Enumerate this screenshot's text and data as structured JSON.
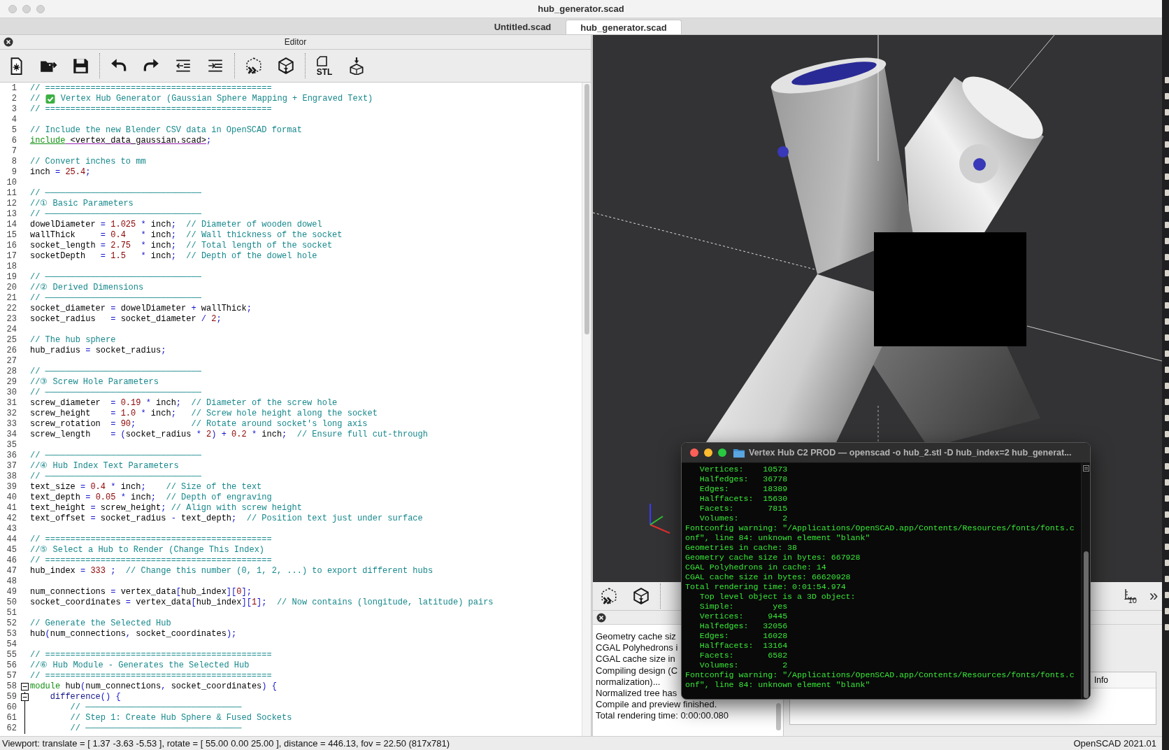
{
  "window": {
    "title": "hub_generator.scad"
  },
  "tabs": [
    {
      "label": "Untitled.scad",
      "selected": false
    },
    {
      "label": "hub_generator.scad",
      "selected": true
    }
  ],
  "editor": {
    "title": "Editor",
    "toolbar": [
      {
        "kind": "new"
      },
      {
        "kind": "open"
      },
      {
        "kind": "save"
      },
      {
        "kind": "separator"
      },
      {
        "kind": "undo"
      },
      {
        "kind": "redo"
      },
      {
        "kind": "unindent"
      },
      {
        "kind": "indent"
      },
      {
        "kind": "separator"
      },
      {
        "kind": "preview"
      },
      {
        "kind": "render"
      },
      {
        "kind": "separator"
      },
      {
        "kind": "export_stl",
        "label": "STL"
      },
      {
        "kind": "print"
      }
    ],
    "lines": [
      {
        "number": "1",
        "segments": [
          {
            "kind": "comment",
            "text": "// ============================================="
          }
        ]
      },
      {
        "number": "2",
        "segments": [
          {
            "kind": "comment",
            "text": "// "
          },
          {
            "kind": "emoji"
          },
          {
            "kind": "comment",
            "text": " Vertex Hub Generator (Gaussian Sphere Mapping + Engraved Text)"
          }
        ]
      },
      {
        "number": "3",
        "segments": [
          {
            "kind": "comment",
            "text": "// ============================================="
          }
        ]
      },
      {
        "number": "4"
      },
      {
        "number": "5",
        "segments": [
          {
            "kind": "comment",
            "text": "// Include the new Blender CSV data in OpenSCAD format"
          }
        ]
      },
      {
        "number": "6",
        "segments": [
          {
            "kind": "include",
            "text": "include"
          },
          {
            "kind": "path",
            "text": " <vertex_data_gaussian.scad>"
          },
          {
            "kind": "op",
            "text": ";"
          }
        ]
      },
      {
        "number": "7"
      },
      {
        "number": "8",
        "segments": [
          {
            "kind": "comment",
            "text": "// Convert inches to mm"
          }
        ]
      },
      {
        "number": "9",
        "segments": [
          {
            "kind": "plain",
            "text": "inch "
          },
          {
            "kind": "op",
            "text": "= "
          },
          {
            "kind": "number",
            "text": "25.4"
          },
          {
            "kind": "op",
            "text": ";"
          }
        ]
      },
      {
        "number": "10"
      },
      {
        "number": "11",
        "segments": [
          {
            "kind": "comment",
            "text": "// ───────────────────────────────"
          }
        ]
      },
      {
        "number": "12",
        "segments": [
          {
            "kind": "comment",
            "text": "//① Basic Parameters"
          }
        ]
      },
      {
        "number": "13",
        "segments": [
          {
            "kind": "comment",
            "text": "// ───────────────────────────────"
          }
        ]
      },
      {
        "number": "14",
        "segments": [
          {
            "kind": "plain",
            "text": "dowelDiameter "
          },
          {
            "kind": "op",
            "text": "= "
          },
          {
            "kind": "number",
            "text": "1.025 "
          },
          {
            "kind": "op",
            "text": "* "
          },
          {
            "kind": "plain",
            "text": "inch"
          },
          {
            "kind": "op",
            "text": ";  "
          },
          {
            "kind": "comment",
            "text": "// Diameter of wooden dowel"
          }
        ]
      },
      {
        "number": "15",
        "segments": [
          {
            "kind": "plain",
            "text": "wallThick     "
          },
          {
            "kind": "op",
            "text": "= "
          },
          {
            "kind": "number",
            "text": "0.4   "
          },
          {
            "kind": "op",
            "text": "* "
          },
          {
            "kind": "plain",
            "text": "inch"
          },
          {
            "kind": "op",
            "text": ";  "
          },
          {
            "kind": "comment",
            "text": "// Wall thickness of the socket"
          }
        ]
      },
      {
        "number": "16",
        "segments": [
          {
            "kind": "plain",
            "text": "socket_length "
          },
          {
            "kind": "op",
            "text": "= "
          },
          {
            "kind": "number",
            "text": "2.75  "
          },
          {
            "kind": "op",
            "text": "* "
          },
          {
            "kind": "plain",
            "text": "inch"
          },
          {
            "kind": "op",
            "text": ";  "
          },
          {
            "kind": "comment",
            "text": "// Total length of the socket"
          }
        ]
      },
      {
        "number": "17",
        "segments": [
          {
            "kind": "plain",
            "text": "socketDepth   "
          },
          {
            "kind": "op",
            "text": "= "
          },
          {
            "kind": "number",
            "text": "1.5   "
          },
          {
            "kind": "op",
            "text": "* "
          },
          {
            "kind": "plain",
            "text": "inch"
          },
          {
            "kind": "op",
            "text": ";  "
          },
          {
            "kind": "comment",
            "text": "// Depth of the dowel hole"
          }
        ]
      },
      {
        "number": "18"
      },
      {
        "number": "19",
        "segments": [
          {
            "kind": "comment",
            "text": "// ───────────────────────────────"
          }
        ]
      },
      {
        "number": "20",
        "segments": [
          {
            "kind": "comment",
            "text": "//② Derived Dimensions"
          }
        ]
      },
      {
        "number": "21",
        "segments": [
          {
            "kind": "comment",
            "text": "// ───────────────────────────────"
          }
        ]
      },
      {
        "number": "22",
        "segments": [
          {
            "kind": "plain",
            "text": "socket_diameter "
          },
          {
            "kind": "op",
            "text": "= "
          },
          {
            "kind": "plain",
            "text": "dowelDiameter "
          },
          {
            "kind": "op",
            "text": "+ "
          },
          {
            "kind": "plain",
            "text": "wallThick"
          },
          {
            "kind": "op",
            "text": ";"
          }
        ]
      },
      {
        "number": "23",
        "segments": [
          {
            "kind": "plain",
            "text": "socket_radius   "
          },
          {
            "kind": "op",
            "text": "= "
          },
          {
            "kind": "plain",
            "text": "socket_diameter "
          },
          {
            "kind": "op",
            "text": "/ "
          },
          {
            "kind": "number",
            "text": "2"
          },
          {
            "kind": "op",
            "text": ";"
          }
        ]
      },
      {
        "number": "24"
      },
      {
        "number": "25",
        "segments": [
          {
            "kind": "comment",
            "text": "// The hub sphere"
          }
        ]
      },
      {
        "number": "26",
        "segments": [
          {
            "kind": "plain",
            "text": "hub_radius "
          },
          {
            "kind": "op",
            "text": "= "
          },
          {
            "kind": "plain",
            "text": "socket_radius"
          },
          {
            "kind": "op",
            "text": ";"
          }
        ]
      },
      {
        "number": "27"
      },
      {
        "number": "28",
        "segments": [
          {
            "kind": "comment",
            "text": "// ───────────────────────────────"
          }
        ]
      },
      {
        "number": "29",
        "segments": [
          {
            "kind": "comment",
            "text": "//③ Screw Hole Parameters"
          }
        ]
      },
      {
        "number": "30",
        "segments": [
          {
            "kind": "comment",
            "text": "// ───────────────────────────────"
          }
        ]
      },
      {
        "number": "31",
        "segments": [
          {
            "kind": "plain",
            "text": "screw_diameter  "
          },
          {
            "kind": "op",
            "text": "= "
          },
          {
            "kind": "number",
            "text": "0.19 "
          },
          {
            "kind": "op",
            "text": "* "
          },
          {
            "kind": "plain",
            "text": "inch"
          },
          {
            "kind": "op",
            "text": ";  "
          },
          {
            "kind": "comment",
            "text": "// Diameter of the screw hole"
          }
        ]
      },
      {
        "number": "32",
        "segments": [
          {
            "kind": "plain",
            "text": "screw_height    "
          },
          {
            "kind": "op",
            "text": "= "
          },
          {
            "kind": "number",
            "text": "1.0 "
          },
          {
            "kind": "op",
            "text": "* "
          },
          {
            "kind": "plain",
            "text": "inch"
          },
          {
            "kind": "op",
            "text": ";   "
          },
          {
            "kind": "comment",
            "text": "// Screw hole height along the socket"
          }
        ]
      },
      {
        "number": "33",
        "segments": [
          {
            "kind": "plain",
            "text": "screw_rotation  "
          },
          {
            "kind": "op",
            "text": "= "
          },
          {
            "kind": "number",
            "text": "90"
          },
          {
            "kind": "op",
            "text": ";           "
          },
          {
            "kind": "comment",
            "text": "// Rotate around socket's long axis"
          }
        ]
      },
      {
        "number": "34",
        "segments": [
          {
            "kind": "plain",
            "text": "screw_length    "
          },
          {
            "kind": "op",
            "text": "= ("
          },
          {
            "kind": "plain",
            "text": "socket_radius "
          },
          {
            "kind": "op",
            "text": "* "
          },
          {
            "kind": "number",
            "text": "2"
          },
          {
            "kind": "op",
            "text": ") + "
          },
          {
            "kind": "number",
            "text": "0.2 "
          },
          {
            "kind": "op",
            "text": "* "
          },
          {
            "kind": "plain",
            "text": "inch"
          },
          {
            "kind": "op",
            "text": ";  "
          },
          {
            "kind": "comment",
            "text": "// Ensure full cut-through"
          }
        ]
      },
      {
        "number": "35"
      },
      {
        "number": "36",
        "segments": [
          {
            "kind": "comment",
            "text": "// ───────────────────────────────"
          }
        ]
      },
      {
        "number": "37",
        "segments": [
          {
            "kind": "comment",
            "text": "//④ Hub Index Text Parameters"
          }
        ]
      },
      {
        "number": "38",
        "segments": [
          {
            "kind": "comment",
            "text": "// ───────────────────────────────"
          }
        ]
      },
      {
        "number": "39",
        "segments": [
          {
            "kind": "plain",
            "text": "text_size "
          },
          {
            "kind": "op",
            "text": "= "
          },
          {
            "kind": "number",
            "text": "0.4 "
          },
          {
            "kind": "op",
            "text": "* "
          },
          {
            "kind": "plain",
            "text": "inch"
          },
          {
            "kind": "op",
            "text": ";    "
          },
          {
            "kind": "comment",
            "text": "// Size of the text"
          }
        ]
      },
      {
        "number": "40",
        "segments": [
          {
            "kind": "plain",
            "text": "text_depth "
          },
          {
            "kind": "op",
            "text": "= "
          },
          {
            "kind": "number",
            "text": "0.05 "
          },
          {
            "kind": "op",
            "text": "* "
          },
          {
            "kind": "plain",
            "text": "inch"
          },
          {
            "kind": "op",
            "text": ";  "
          },
          {
            "kind": "comment",
            "text": "// Depth of engraving"
          }
        ]
      },
      {
        "number": "41",
        "segments": [
          {
            "kind": "plain",
            "text": "text_height "
          },
          {
            "kind": "op",
            "text": "= "
          },
          {
            "kind": "plain",
            "text": "screw_height"
          },
          {
            "kind": "op",
            "text": "; "
          },
          {
            "kind": "comment",
            "text": "// Align with screw height"
          }
        ]
      },
      {
        "number": "42",
        "segments": [
          {
            "kind": "plain",
            "text": "text_offset "
          },
          {
            "kind": "op",
            "text": "= "
          },
          {
            "kind": "plain",
            "text": "socket_radius "
          },
          {
            "kind": "op",
            "text": "- "
          },
          {
            "kind": "plain",
            "text": "text_depth"
          },
          {
            "kind": "op",
            "text": ";  "
          },
          {
            "kind": "comment",
            "text": "// Position text just under surface"
          }
        ]
      },
      {
        "number": "43"
      },
      {
        "number": "44",
        "segments": [
          {
            "kind": "comment",
            "text": "// ============================================="
          }
        ]
      },
      {
        "number": "45",
        "segments": [
          {
            "kind": "comment",
            "text": "//⑤ Select a Hub to Render (Change This Index)"
          }
        ]
      },
      {
        "number": "46",
        "segments": [
          {
            "kind": "comment",
            "text": "// ============================================="
          }
        ]
      },
      {
        "number": "47",
        "segments": [
          {
            "kind": "plain",
            "text": "hub_index "
          },
          {
            "kind": "op",
            "text": "= "
          },
          {
            "kind": "number",
            "text": "333 "
          },
          {
            "kind": "op",
            "text": ";  "
          },
          {
            "kind": "comment",
            "text": "// Change this number (0, 1, 2, ...) to export different hubs"
          }
        ]
      },
      {
        "number": "48"
      },
      {
        "number": "49",
        "segments": [
          {
            "kind": "plain",
            "text": "num_connections "
          },
          {
            "kind": "op",
            "text": "= "
          },
          {
            "kind": "plain",
            "text": "vertex_data"
          },
          {
            "kind": "op",
            "text": "["
          },
          {
            "kind": "plain",
            "text": "hub_index"
          },
          {
            "kind": "op",
            "text": "]["
          },
          {
            "kind": "number",
            "text": "0"
          },
          {
            "kind": "op",
            "text": "];"
          }
        ]
      },
      {
        "number": "50",
        "segments": [
          {
            "kind": "plain",
            "text": "socket_coordinates "
          },
          {
            "kind": "op",
            "text": "= "
          },
          {
            "kind": "plain",
            "text": "vertex_data"
          },
          {
            "kind": "op",
            "text": "["
          },
          {
            "kind": "plain",
            "text": "hub_index"
          },
          {
            "kind": "op",
            "text": "]["
          },
          {
            "kind": "number",
            "text": "1"
          },
          {
            "kind": "op",
            "text": "];  "
          },
          {
            "kind": "comment",
            "text": "// Now contains (longitude, latitude) pairs"
          }
        ]
      },
      {
        "number": "51"
      },
      {
        "number": "52",
        "segments": [
          {
            "kind": "comment",
            "text": "// Generate the Selected Hub"
          }
        ]
      },
      {
        "number": "53",
        "segments": [
          {
            "kind": "plain",
            "text": "hub"
          },
          {
            "kind": "op",
            "text": "("
          },
          {
            "kind": "plain",
            "text": "num_connections"
          },
          {
            "kind": "op",
            "text": ", "
          },
          {
            "kind": "plain",
            "text": "socket_coordinates"
          },
          {
            "kind": "op",
            "text": ");"
          }
        ]
      },
      {
        "number": "54"
      },
      {
        "number": "55",
        "segments": [
          {
            "kind": "comment",
            "text": "// ============================================="
          }
        ]
      },
      {
        "number": "56",
        "segments": [
          {
            "kind": "comment",
            "text": "//⑥ Hub Module - Generates the Selected Hub"
          }
        ]
      },
      {
        "number": "57",
        "segments": [
          {
            "kind": "comment",
            "text": "// ============================================="
          }
        ]
      },
      {
        "number": "58",
        "fold": {
          "expanded": true
        },
        "segments": [
          {
            "kind": "keyword",
            "text": "module"
          },
          {
            "kind": "plain",
            "text": " hub"
          },
          {
            "kind": "op",
            "text": "("
          },
          {
            "kind": "plain",
            "text": "num_connections"
          },
          {
            "kind": "op",
            "text": ", "
          },
          {
            "kind": "plain",
            "text": "socket_coordinates"
          },
          {
            "kind": "op",
            "text": ") {"
          }
        ]
      },
      {
        "number": "59",
        "fold": {
          "expanded": true
        },
        "segments": [
          {
            "kind": "builtin",
            "text": "    difference"
          },
          {
            "kind": "op",
            "text": "() {"
          }
        ]
      },
      {
        "number": "60",
        "segments": [
          {
            "kind": "comment",
            "text": "        // ───────────────────────────────"
          }
        ]
      },
      {
        "number": "61",
        "segments": [
          {
            "kind": "comment",
            "text": "        // Step 1: Create Hub Sphere & Fused Sockets"
          }
        ]
      },
      {
        "number": "62",
        "segments": [
          {
            "kind": "comment",
            "text": "        // ───────────────────────────────"
          }
        ]
      }
    ]
  },
  "viewport": {
    "kind": "picture",
    "toolbar": [
      {
        "kind": "preview"
      },
      {
        "kind": "render"
      },
      {
        "kind": "separator"
      },
      {
        "kind": "axes_scale",
        "label": "10"
      },
      {
        "kind": "more",
        "label": "»"
      }
    ]
  },
  "console": {
    "lines": [
      "Geometry cache siz",
      "CGAL Polyhedrons i",
      "CGAL cache size in",
      "Compiling design (C",
      "normalization)...",
      "Normalized tree has",
      "Compile and preview finished.",
      "Total rendering time: 0:00:00.080"
    ],
    "columns": [
      "Info"
    ]
  },
  "terminal": {
    "title": "Vertex Hub C2 PROD — openscad -o hub_2.stl -D hub_index=2 hub_generat...",
    "lines": [
      "   Vertices:    10573",
      "   Halfedges:   36778",
      "   Edges:       18389",
      "   Halffacets:  15630",
      "   Facets:       7815",
      "   Volumes:         2",
      "Fontconfig warning: \"/Applications/OpenSCAD.app/Contents/Resources/fonts/fonts.c",
      "onf\", line 84: unknown element \"blank\"",
      "Geometries in cache: 38",
      "Geometry cache size in bytes: 667928",
      "CGAL Polyhedrons in cache: 14",
      "CGAL cache size in bytes: 66620928",
      "Total rendering time: 0:01:54.974",
      "   Top level object is a 3D object:",
      "   Simple:        yes",
      "   Vertices:     9445",
      "   Halfedges:   32056",
      "   Edges:       16028",
      "   Halffacets:  13164",
      "   Facets:       6582",
      "   Volumes:         2",
      "Fontconfig warning: \"/Applications/OpenSCAD.app/Contents/Resources/fonts/fonts.c",
      "onf\", line 84: unknown element \"blank\""
    ]
  },
  "status_bar": {
    "viewport": "Viewport: translate = [ 1.37 -3.63 -5.53 ], rotate = [ 55.00 0.00 25.00 ], distance = 446.13, fov = 22.50 (817x781)",
    "version": "OpenSCAD 2021.01"
  }
}
